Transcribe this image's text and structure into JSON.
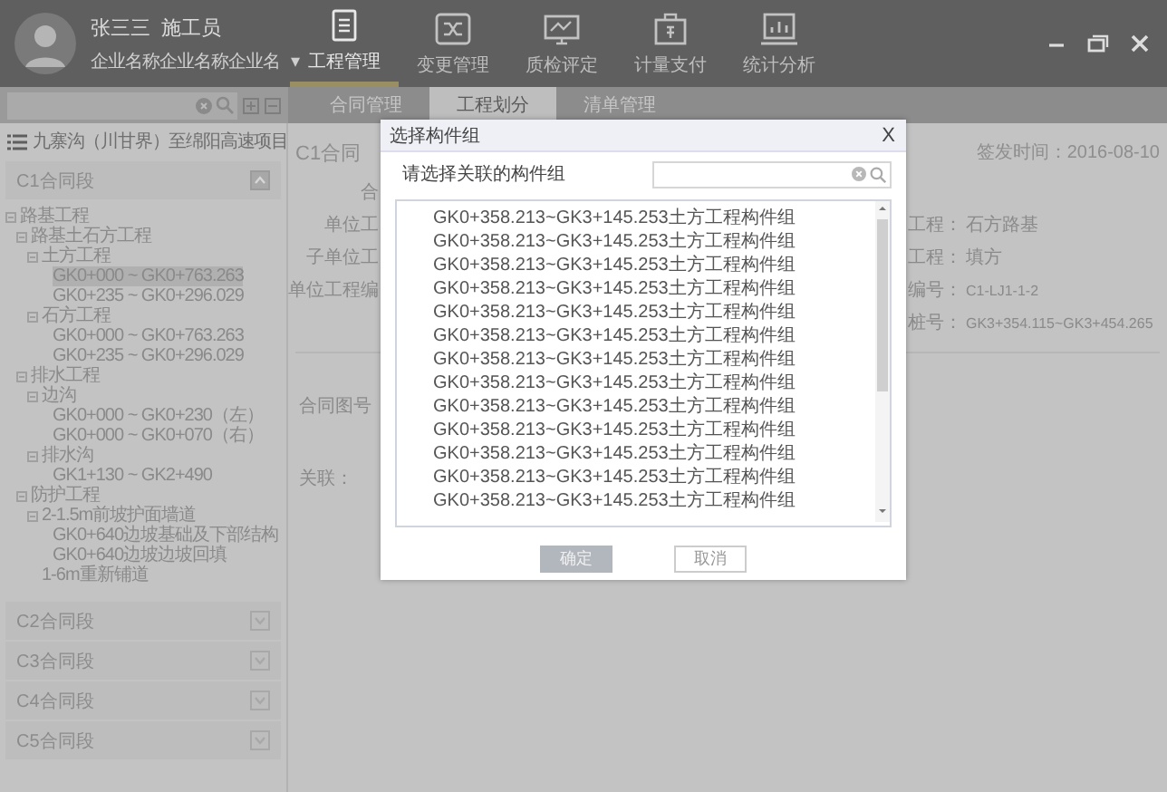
{
  "user": {
    "name": "张三三",
    "role": "施工员",
    "company": "企业名称企业名称企业名",
    "caret": "▾"
  },
  "nav": [
    {
      "label": "工程管理",
      "selected": true
    },
    {
      "label": "变更管理",
      "selected": false
    },
    {
      "label": "质检评定",
      "selected": false
    },
    {
      "label": "计量支付",
      "selected": false
    },
    {
      "label": "统计分析",
      "selected": false
    }
  ],
  "tabs": [
    {
      "label": "合同管理",
      "selected": false
    },
    {
      "label": "工程划分",
      "selected": true
    },
    {
      "label": "清单管理",
      "selected": false
    }
  ],
  "sidebar": {
    "project": "九寨沟（川甘界）至绵阳高速项目",
    "sections": [
      {
        "label": "C1合同段",
        "expanded": true,
        "tree": [
          {
            "label": "路基工程",
            "selected": false,
            "children": [
              {
                "label": "路基土石方工程",
                "selected": false,
                "children": [
                  {
                    "label": "土方工程",
                    "selected": false,
                    "children": [
                      {
                        "label": "GK0+000 ~ GK0+763.263",
                        "selected": true
                      },
                      {
                        "label": "GK0+235 ~ GK0+296.029",
                        "selected": false
                      }
                    ]
                  },
                  {
                    "label": "石方工程",
                    "selected": false,
                    "children": [
                      {
                        "label": "GK0+000 ~ GK0+763.263",
                        "selected": false
                      },
                      {
                        "label": "GK0+235 ~ GK0+296.029",
                        "selected": false
                      }
                    ]
                  }
                ]
              },
              {
                "label": "排水工程",
                "selected": false,
                "children": [
                  {
                    "label": "边沟",
                    "selected": false,
                    "children": [
                      {
                        "label": "GK0+000 ~ GK0+230（左）",
                        "selected": false
                      },
                      {
                        "label": "GK0+000 ~ GK0+070（右）",
                        "selected": false
                      }
                    ]
                  },
                  {
                    "label": "排水沟",
                    "selected": false,
                    "children": [
                      {
                        "label": "GK1+130 ~ GK2+490",
                        "selected": false
                      }
                    ]
                  }
                ]
              },
              {
                "label": "防护工程",
                "selected": false,
                "children": [
                  {
                    "label": "2-1.5m前坡护面墙道",
                    "selected": false,
                    "children": [
                      {
                        "label": "GK0+640边坡基础及下部结构",
                        "selected": false
                      },
                      {
                        "label": "GK0+640边坡边坡回填",
                        "selected": false
                      }
                    ]
                  },
                  {
                    "label": "1-6m重新铺道",
                    "selected": false
                  }
                ]
              }
            ]
          }
        ]
      },
      {
        "label": "C2合同段",
        "expanded": false
      },
      {
        "label": "C3合同段",
        "expanded": false
      },
      {
        "label": "C4合同段",
        "expanded": false
      },
      {
        "label": "C5合同段",
        "expanded": false
      }
    ]
  },
  "main": {
    "title": "C1合同",
    "issued": "签发时间：2016-08-10",
    "left_labels": [
      "合",
      "单位工",
      "子单位工",
      "单位工程编"
    ],
    "right_fields": [
      {
        "label": "工程：",
        "value": "石方路基"
      },
      {
        "label": "工程：",
        "value": "填方"
      },
      {
        "label": "编号：",
        "value": "C1-LJ1-1-2"
      },
      {
        "label": "桩号：",
        "value": "GK3+354.115~GK3+454.265"
      }
    ],
    "lower_labels": [
      "合同图号",
      "关联："
    ]
  },
  "dialog": {
    "title": "选择构件组",
    "close": "X",
    "prompt": "请选择关联的构件组",
    "items": [
      {
        "label": "GK0+358.213~GK3+145.253土方工程构件组",
        "selected": false
      },
      {
        "label": "GK0+358.213~GK3+145.253土方工程构件组",
        "selected": false
      },
      {
        "label": "GK0+358.213~GK3+145.253土方工程构件组",
        "selected": false
      },
      {
        "label": "GK0+358.213~GK3+145.253土方工程构件组",
        "selected": false
      },
      {
        "label": "GK0+358.213~GK3+145.253土方工程构件组",
        "selected": false
      },
      {
        "label": "GK0+358.213~GK3+145.253土方工程构件组",
        "selected": false
      },
      {
        "label": "GK0+358.213~GK3+145.253土方工程构件组",
        "selected": false
      },
      {
        "label": "GK0+358.213~GK3+145.253土方工程构件组",
        "selected": false
      },
      {
        "label": "GK0+358.213~GK3+145.253土方工程构件组",
        "selected": false
      },
      {
        "label": "GK0+358.213~GK3+145.253土方工程构件组",
        "selected": false
      },
      {
        "label": "GK0+358.213~GK3+145.253土方工程构件组",
        "selected": false
      },
      {
        "label": "GK0+358.213~GK3+145.253土方工程构件组",
        "selected": false
      },
      {
        "label": "GK0+358.213~GK3+145.253土方工程构件组",
        "selected": false
      }
    ],
    "buttons": [
      {
        "label": "确定",
        "kind": "primary"
      },
      {
        "label": "取消",
        "kind": "secondary"
      }
    ]
  }
}
